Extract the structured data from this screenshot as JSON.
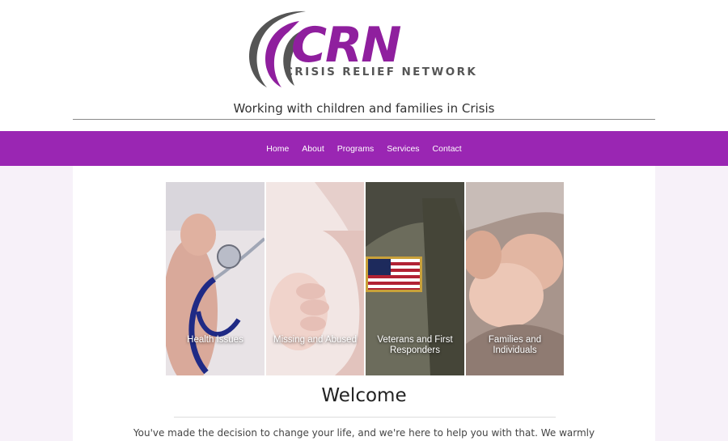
{
  "brand": {
    "logo_letters": "CRN",
    "name": "CRISIS RELIEF NETWORK",
    "tagline": "Working with children and families in Crisis",
    "accent_color": "#9a26b3"
  },
  "nav": {
    "items": [
      {
        "label": "Home"
      },
      {
        "label": "About"
      },
      {
        "label": "Programs"
      },
      {
        "label": "Services"
      },
      {
        "label": "Contact"
      }
    ]
  },
  "tiles": [
    {
      "label": "Health Issues",
      "image": "baby-with-stethoscope"
    },
    {
      "label": "Missing and Abused",
      "image": "baby-hand-holding-finger"
    },
    {
      "label": "Veterans and First Responders",
      "image": "soldier-with-flag-patch"
    },
    {
      "label": "Families and Individuals",
      "image": "holding-hands"
    }
  ],
  "welcome": {
    "heading": "Welcome",
    "intro": "You've made the decision to change your life, and we're here to help you with that. We warmly"
  }
}
